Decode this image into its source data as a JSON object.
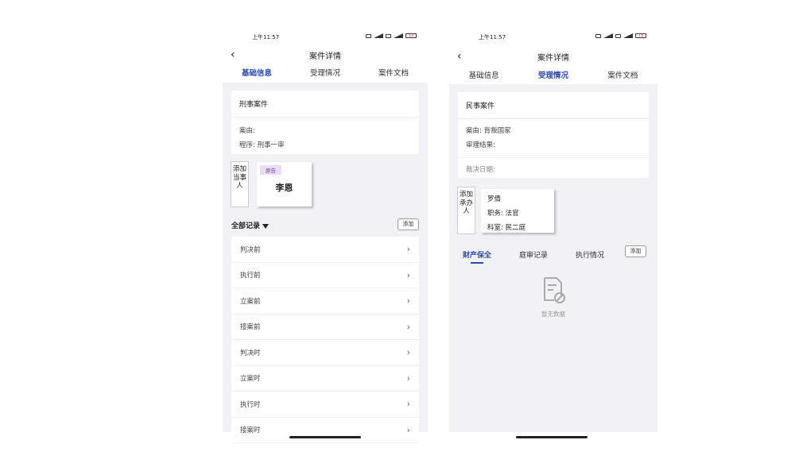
{
  "status_bar": {
    "time": "上午11:57",
    "battery": "13"
  },
  "navbar": {
    "title": "案件详情"
  },
  "tabs": [
    "基础信息",
    "受理情况",
    "案件文档"
  ],
  "screen1": {
    "case_type": "刑事案件",
    "cause_label": "案由:",
    "procedure_label": "程序:",
    "procedure_value": "刑事一审",
    "add_party_label": "添加当事人",
    "party": {
      "tag": "原告",
      "name": "李恩"
    },
    "records_title": "全部记录",
    "add_label": "添加",
    "records": [
      "判决前",
      "执行前",
      "立案前",
      "接案前",
      "判决时",
      "立案时",
      "执行时",
      "接案时"
    ]
  },
  "screen2": {
    "case_type": "民事案件",
    "cause_label": "案由:",
    "cause_value": "背叛国家",
    "result_label": "审理结果:",
    "judgment_date_label": "裁决日期:",
    "add_handler_label": "添加承办人",
    "handler": {
      "name": "罗倩",
      "title_label": "职务:",
      "title_value": "法官",
      "dept_label": "科室:",
      "dept_value": "民二庭"
    },
    "subtabs": [
      "财产保全",
      "庭审记录",
      "执行情况"
    ],
    "add_label": "添加",
    "empty_text": "暂无数据"
  },
  "colors": {
    "accent": "#2d4aa8",
    "tag_bg": "#e9dcf3",
    "page_bg": "#f2f2f4"
  }
}
